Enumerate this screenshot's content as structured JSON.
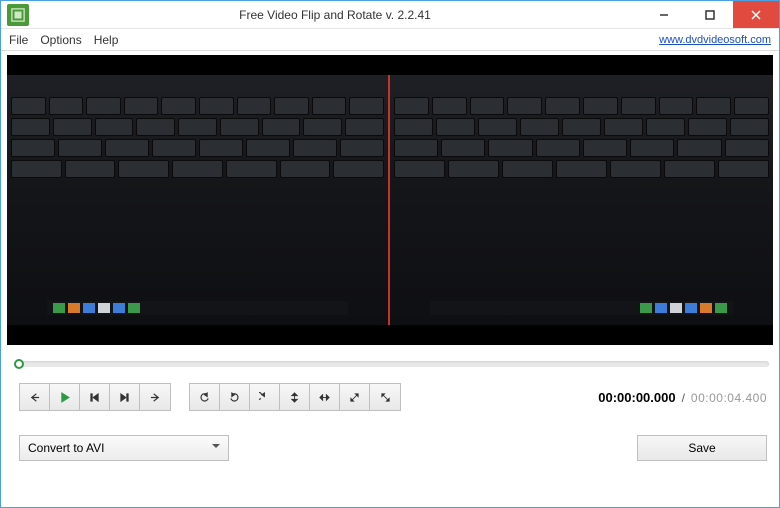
{
  "window": {
    "title": "Free Video Flip and Rotate v. 2.2.41"
  },
  "menu": {
    "file": "File",
    "options": "Options",
    "help": "Help",
    "site_link": "www.dvdvideosoft.com"
  },
  "time": {
    "current": "00:00:00.000",
    "separator": "/",
    "total": "00:00:04.400"
  },
  "format": {
    "selected": "Convert to AVI"
  },
  "actions": {
    "save": "Save"
  },
  "icons": {
    "back": "back",
    "play": "play",
    "step_back": "step-back",
    "step_fwd": "step-forward",
    "forward": "forward",
    "rotate_ccw": "rotate-ccw",
    "rotate_180": "rotate-180",
    "rotate_cw": "rotate-cw",
    "flip_v": "flip-vertical",
    "flip_h": "flip-horizontal",
    "diag1": "flip-diagonal-1",
    "diag2": "flip-diagonal-2"
  }
}
